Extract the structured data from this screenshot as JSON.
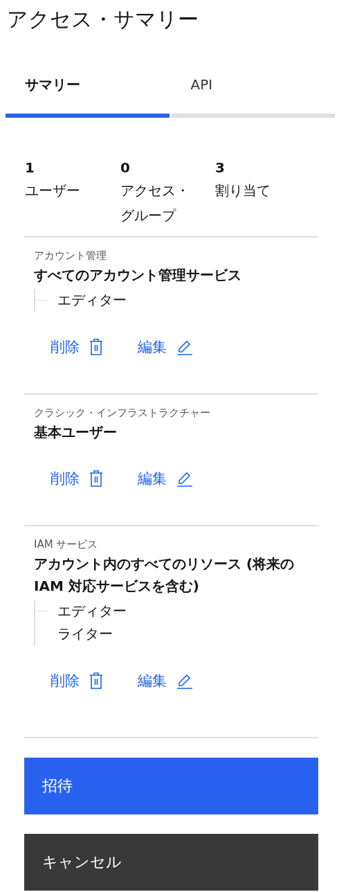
{
  "title": "アクセス・サマリー",
  "tabs": [
    {
      "label": "サマリー",
      "selected": true
    },
    {
      "label": "API",
      "selected": false
    }
  ],
  "stats": [
    {
      "value": "1",
      "label": "ユーザー"
    },
    {
      "value": "0",
      "label": "アクセス・グループ"
    },
    {
      "value": "3",
      "label": "割り当て"
    }
  ],
  "policies": [
    {
      "category": "アカウント管理",
      "name": "すべてのアカウント管理サービス",
      "roles": [
        "エディター"
      ],
      "delete": "削除",
      "edit": "編集"
    },
    {
      "category": "クラシック・インフラストラクチャー",
      "name": "基本ユーザー",
      "delete": "削除",
      "edit": "編集"
    },
    {
      "category": "IAM サービス",
      "name": "アカウント内のすべてのリソース (将来の IAM 対応サービスを含む)",
      "roles": [
        "エディター",
        "ライター"
      ],
      "delete": "削除",
      "edit": "編集"
    }
  ],
  "buttons": [
    {
      "label": "招待",
      "kind": "primary"
    },
    {
      "label": "キャンセル",
      "kind": "secondary"
    }
  ]
}
